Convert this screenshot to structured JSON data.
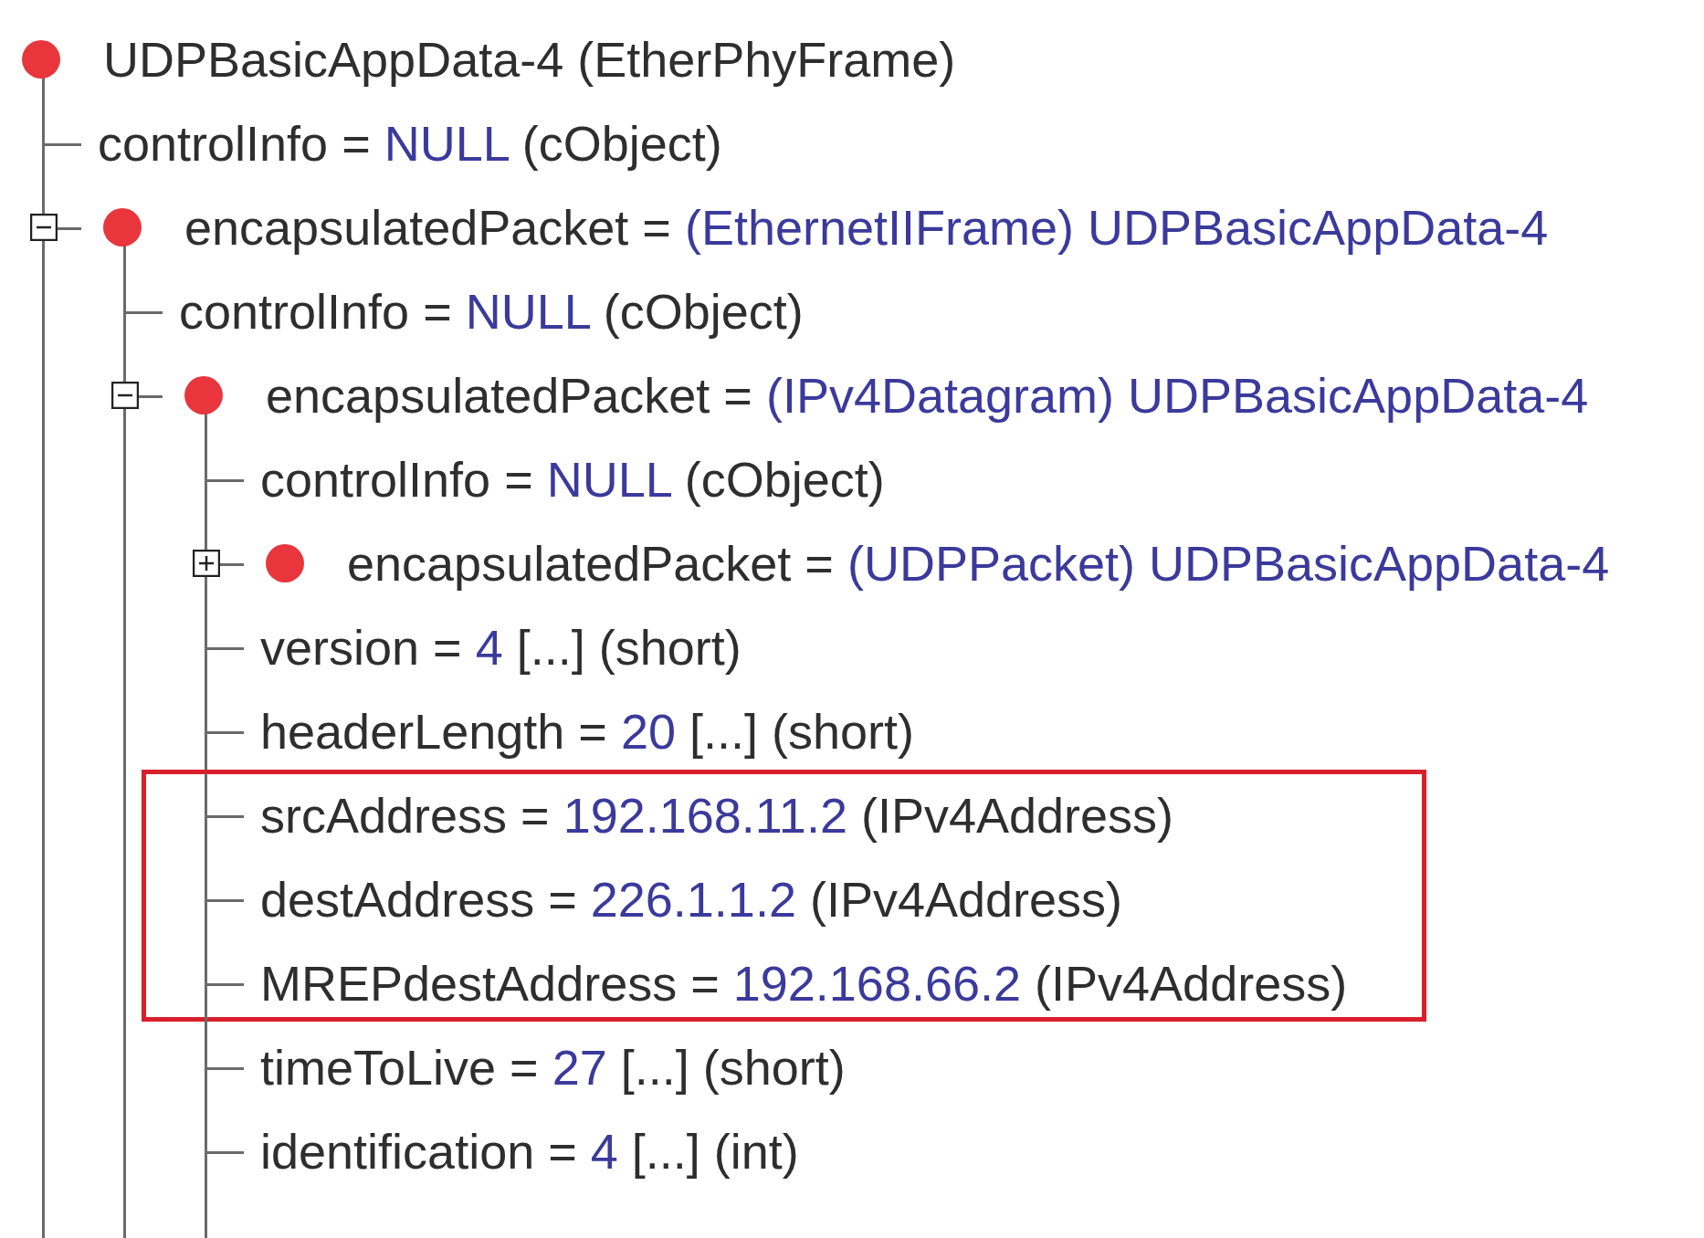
{
  "tree": {
    "label": "UDPBasicAppData-4 (EtherPhyFrame)",
    "dot": true,
    "children": [
      {
        "label": "controlInfo =",
        "value": "NULL",
        "type": "(cObject)"
      },
      {
        "label": "encapsulatedPacket =",
        "value": "(EthernetIIFrame) UDPBasicAppData-4",
        "dot": true,
        "expanded": true,
        "children": [
          {
            "label": "controlInfo =",
            "value": "NULL",
            "type": "(cObject)"
          },
          {
            "label": "encapsulatedPacket =",
            "value": "(IPv4Datagram) UDPBasicAppData-4",
            "dot": true,
            "expanded": true,
            "children": [
              {
                "label": "controlInfo =",
                "value": "NULL",
                "type": "(cObject)"
              },
              {
                "label": "encapsulatedPacket =",
                "value": "(UDPPacket) UDPBasicAppData-4",
                "dot": true,
                "expanded": false
              },
              {
                "label": "version =",
                "value": "4",
                "type": "[...]  (short)"
              },
              {
                "label": "headerLength =",
                "value": "20",
                "type": "[...]  (short)"
              },
              {
                "label": "srcAddress =",
                "value": "192.168.11.2",
                "type": "(IPv4Address)",
                "highlighted": true
              },
              {
                "label": "destAddress =",
                "value": "226.1.1.2",
                "type": "(IPv4Address)",
                "highlighted": true
              },
              {
                "label": "MREPdestAddress =",
                "value": "192.168.66.2",
                "type": "(IPv4Address)",
                "highlighted": true
              },
              {
                "label": "timeToLive =",
                "value": "27",
                "type": "[...]  (short)"
              },
              {
                "label": "identification =",
                "value": "4",
                "type": "[...]  (int)"
              }
            ]
          }
        ]
      }
    ]
  }
}
